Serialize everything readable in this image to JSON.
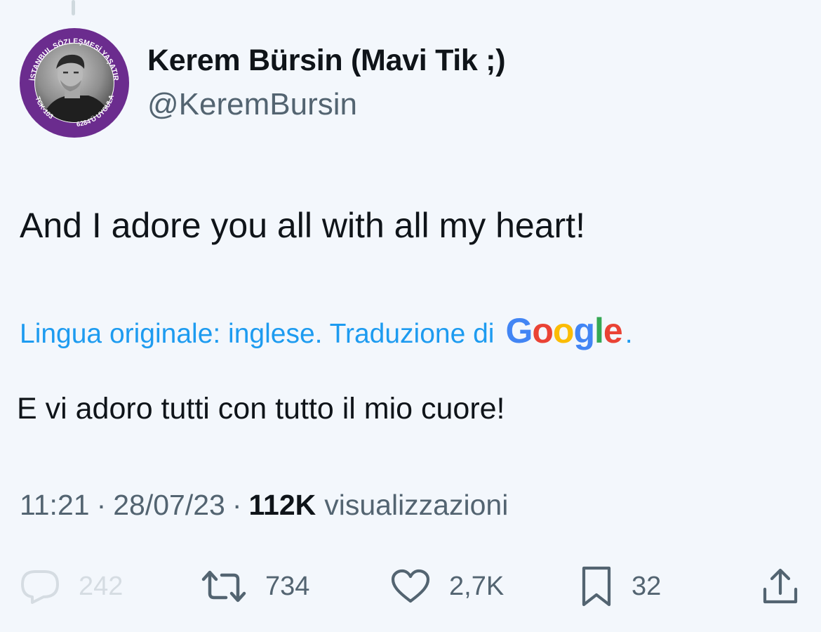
{
  "author": {
    "display_name": "Kerem Bürsin (Mavi Tik ;)",
    "handle": "@KeremBursin",
    "avatar_ring_text": "İSTANBUL SÖZLEŞMESİ YAŞATIR",
    "avatar_ring_bottom_left": "TCK-103",
    "avatar_ring_bottom_right": "6284'Ü UYGULA",
    "avatar_ring_color": "#6b2c8e"
  },
  "tweet": {
    "text": "And I adore you all with all my heart!",
    "translation_label": "Lingua originale: inglese. Traduzione di",
    "translation_provider": "Google",
    "translation_suffix": ".",
    "translated_text": "E vi adoro tutti con tutto il mio cuore!"
  },
  "meta": {
    "time": "11:21",
    "separator": "·",
    "date": "28/07/23",
    "views_count": "112K",
    "views_label": "visualizzazioni"
  },
  "actions": {
    "replies": "242",
    "retweets": "734",
    "likes": "2,7K",
    "bookmarks": "32"
  },
  "colors": {
    "background": "#f3f7fc",
    "link_blue": "#1d9bf0",
    "secondary_text": "#536471",
    "primary_text": "#0f1419"
  },
  "icons": [
    "reply-icon",
    "retweet-icon",
    "heart-icon",
    "bookmark-icon",
    "share-icon"
  ]
}
